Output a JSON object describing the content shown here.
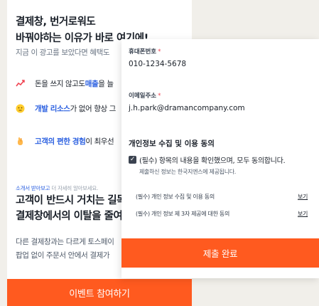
{
  "back": {
    "headline_line1": "결제창, 번거로워도",
    "headline_line2": "바꿔야하는 이유가 바로 여기에!",
    "subtitle": "지금 이 광고를 보았다면 혜택도",
    "features": [
      {
        "icon": "chart-icon",
        "pre": "돈을 쓰지 않고도 ",
        "strong": "매출",
        "post": "을 늘"
      },
      {
        "icon": "emoji-icon",
        "pre": "",
        "strong": "개발 리소스",
        "post": "가 없어 향상 그"
      },
      {
        "icon": "hand-icon",
        "pre": "",
        "strong": "고객의 편한 경험",
        "post": "이 최우선"
      }
    ],
    "kicker_strong": "소개서 받아보고",
    "kicker_muted": " 더 자세히 알아보세요.",
    "section_title_line1": "고객이 반드시 거치는 길목",
    "section_title_line2": "결제창에서의 이탈을 줄여",
    "section_body_line1": "다른 결제창과는 다르게 토스페이",
    "section_body_line2": "팝업 없이 주문서 안에서 결제가",
    "cta": "이벤트 참여하기"
  },
  "modal": {
    "phone_label": "휴대폰번호",
    "phone_value": "010-1234-5678",
    "email_label": "이메일주소",
    "email_value": "j.h.park@dramancompany.com",
    "required_mark": "*",
    "privacy_title": "개인정보 수집 및 이용 동의",
    "agree_text": "(필수) 항목의 내용을 확인했으며, 모두 동의합니다.",
    "agree_note": "제출하신 정보는 한국지엔스에 제공됩니다.",
    "policies": [
      {
        "label": "(필수) 개인 정보 수집 및 이용 동의",
        "view": "보기"
      },
      {
        "label": "(필수) 개인 정보 제 3자 제공에 대한 동의",
        "view": "보기"
      }
    ],
    "submit": "제출 완료"
  },
  "colors": {
    "accent": "#ff5a1f",
    "link_blue": "#2a5fe0",
    "background": "#f1efea"
  }
}
